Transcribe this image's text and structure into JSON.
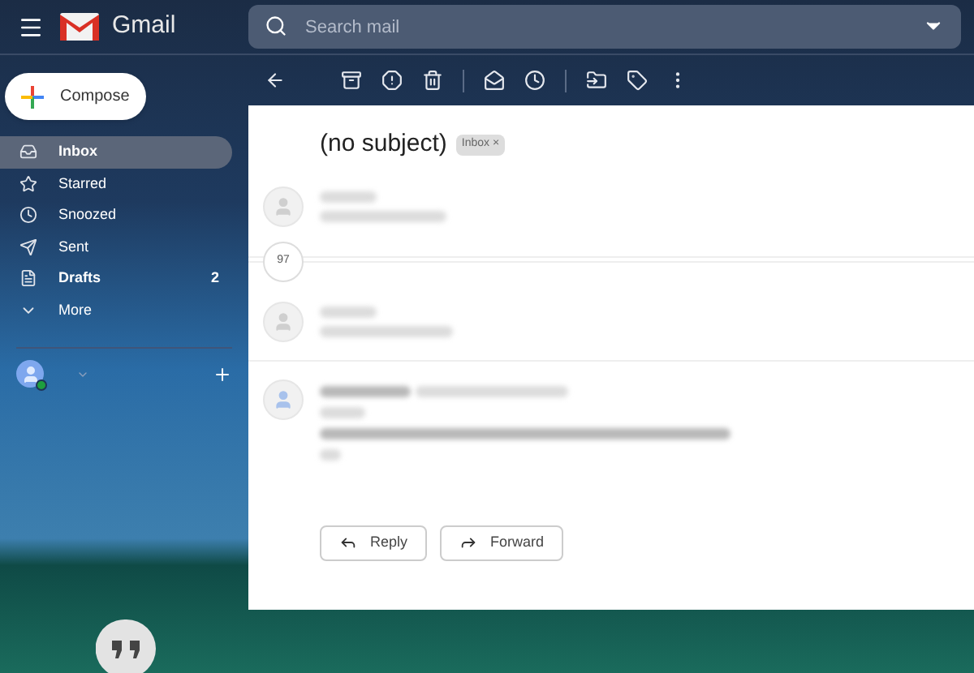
{
  "header": {
    "app_name": "Gmail",
    "search": {
      "placeholder": "Search mail"
    }
  },
  "compose": {
    "label": "Compose"
  },
  "nav": [
    {
      "label": "Inbox",
      "kind": "inbox",
      "selected": true,
      "unread": true
    },
    {
      "label": "Starred",
      "kind": "star",
      "selected": false,
      "unread": false
    },
    {
      "label": "Snoozed",
      "kind": "clock",
      "selected": false,
      "unread": false
    },
    {
      "label": "Sent",
      "kind": "send",
      "selected": false,
      "unread": false
    },
    {
      "label": "Drafts",
      "kind": "file",
      "selected": false,
      "unread": true,
      "count": "2"
    },
    {
      "label": "More",
      "kind": "chevron",
      "selected": false,
      "unread": false
    }
  ],
  "thread": {
    "subject": "(no subject)",
    "label_chip": {
      "label": "Inbox",
      "remove": "×"
    },
    "collapsed_count": "97",
    "actions": [
      {
        "label": "Reply",
        "kind": "reply"
      },
      {
        "label": "Forward",
        "kind": "forward"
      }
    ]
  }
}
